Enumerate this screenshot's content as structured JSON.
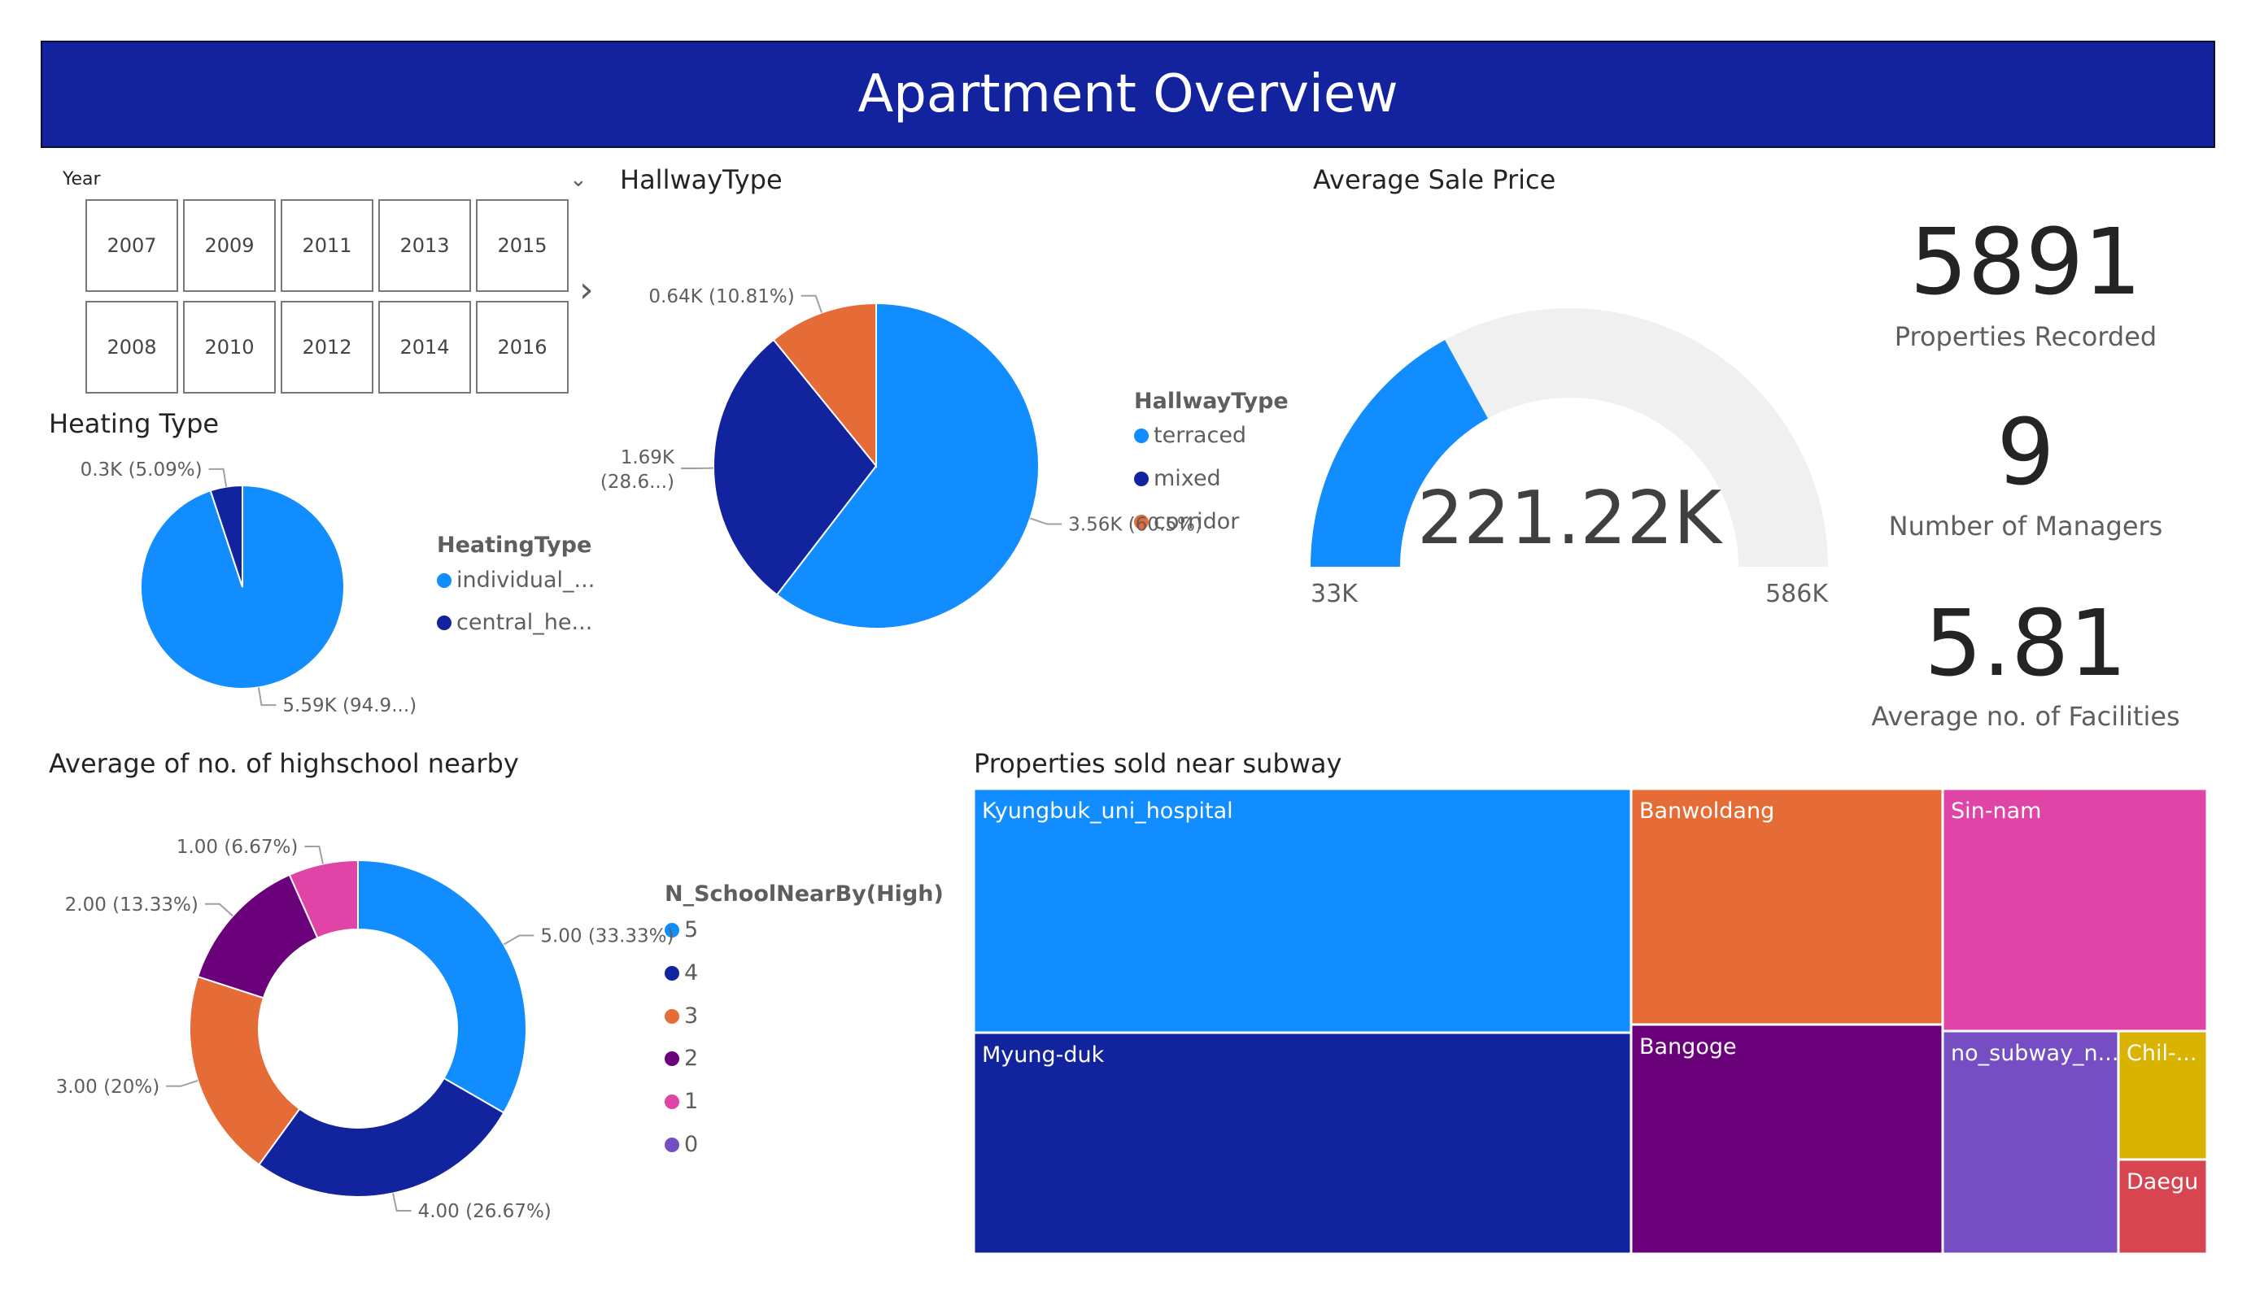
{
  "title": "Apartment Overview",
  "slicer": {
    "label": "Year",
    "years": [
      "2007",
      "2009",
      "2011",
      "2013",
      "2015",
      "2008",
      "2010",
      "2012",
      "2014",
      "2016"
    ],
    "chevron": "⌄",
    "next": "›"
  },
  "colors": {
    "banner": "#13239e",
    "lightblue": "#118dff",
    "navy": "#12239e",
    "orange": "#e66c37",
    "purple": "#6b007b",
    "pink": "#e044a7",
    "violet": "#744ec2",
    "gold": "#d9b300",
    "red": "#d64550",
    "gauge_track": "#f0f0f0"
  },
  "kpis": [
    {
      "value": "5891",
      "label": "Properties Recorded"
    },
    {
      "value": "9",
      "label": "Number of Managers"
    },
    {
      "value": "5.81",
      "label": "Average no. of Facilities"
    }
  ],
  "chart_data": [
    {
      "type": "pie",
      "title": "Heating Type",
      "legend_title": "HeatingType",
      "legend": [
        "individual_...",
        "central_he..."
      ],
      "slices": [
        {
          "name": "individual_heating",
          "value": 5.59,
          "label": "5.59K (94.9...)"
        },
        {
          "name": "central_heating",
          "value": 0.3,
          "label": "0.3K (5.09%)"
        }
      ]
    },
    {
      "type": "pie",
      "title": "HallwayType",
      "legend_title": "HallwayType",
      "legend": [
        "terraced",
        "mixed",
        "corridor"
      ],
      "slices": [
        {
          "name": "terraced",
          "value": 3.56,
          "label": "3.56K (60.5%)"
        },
        {
          "name": "mixed",
          "value": 1.69,
          "label_lines": [
            "1.69K",
            "(28.6...)"
          ]
        },
        {
          "name": "corridor",
          "value": 0.64,
          "label": "0.64K (10.81%)"
        }
      ]
    },
    {
      "type": "gauge",
      "title": "Average Sale Price",
      "value": 221.22,
      "value_label": "221.22K",
      "min": 33,
      "min_label": "33K",
      "max": 586,
      "max_label": "586K"
    },
    {
      "type": "donut",
      "title": "Average of no. of highschool nearby",
      "legend_title": "N_SchoolNearBy(High)",
      "legend": [
        "5",
        "4",
        "3",
        "2",
        "1",
        "0"
      ],
      "slices": [
        {
          "name": "5",
          "value": 5.0,
          "label": "5.00 (33.33%)"
        },
        {
          "name": "4",
          "value": 4.0,
          "label": "4.00 (26.67%)"
        },
        {
          "name": "3",
          "value": 3.0,
          "label": "3.00 (20%)"
        },
        {
          "name": "2",
          "value": 2.0,
          "label": "2.00 (13.33%)"
        },
        {
          "name": "1",
          "value": 1.0,
          "label": "1.00 (6.67%)"
        }
      ]
    },
    {
      "type": "treemap",
      "title": "Properties sold near subway",
      "items": [
        {
          "name": "Kyungbuk_uni_hospital",
          "label": "Kyungbuk_uni_hospital"
        },
        {
          "name": "Myung-duk",
          "label": "Myung-duk"
        },
        {
          "name": "Banwoldang",
          "label": "Banwoldang"
        },
        {
          "name": "Bangoge",
          "label": "Bangoge"
        },
        {
          "name": "Sin-nam",
          "label": "Sin-nam"
        },
        {
          "name": "no_subway_nearby",
          "label": "no_subway_n..."
        },
        {
          "name": "Chil-gok",
          "label": "Chil-..."
        },
        {
          "name": "Daegu",
          "label": "Daegu"
        }
      ]
    }
  ]
}
